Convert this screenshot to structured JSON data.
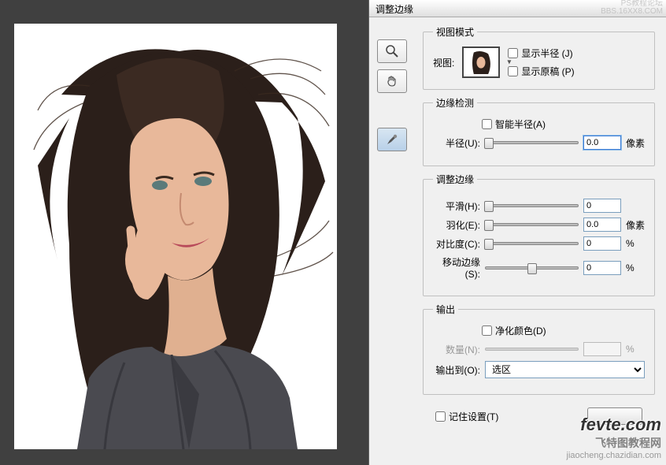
{
  "watermark_top_line1": "PS教程论坛",
  "watermark_top_line2": "BBS.16XX8.COM",
  "dialog": {
    "title": "调整边缘",
    "view_mode": {
      "legend": "视图模式",
      "view_label": "视图:",
      "show_radius": "显示半径 (J)",
      "show_original": "显示原稿 (P)"
    },
    "edge_detect": {
      "legend": "边缘检测",
      "smart_radius": "智能半径(A)",
      "radius_label": "半径(U):",
      "radius_value": "0.0",
      "radius_unit": "像素"
    },
    "adjust": {
      "legend": "调整边缘",
      "rows": [
        {
          "label": "平滑(H):",
          "value": "0",
          "unit": ""
        },
        {
          "label": "羽化(E):",
          "value": "0.0",
          "unit": "像素"
        },
        {
          "label": "对比度(C):",
          "value": "0",
          "unit": "%"
        },
        {
          "label": "移动边缘(S):",
          "value": "0",
          "unit": "%"
        }
      ]
    },
    "output": {
      "legend": "输出",
      "decontaminate": "净化颜色(D)",
      "amount_label": "数量(N):",
      "amount_unit": "%",
      "output_to": "输出到(O):",
      "output_to_value": "选区"
    },
    "remember": "记住设置(T)"
  },
  "watermark_bottom": {
    "logo1": "fevte",
    "logo2": ".com",
    "sub": "飞特图教程网",
    "url": "jiaocheng.chazidian.com"
  }
}
